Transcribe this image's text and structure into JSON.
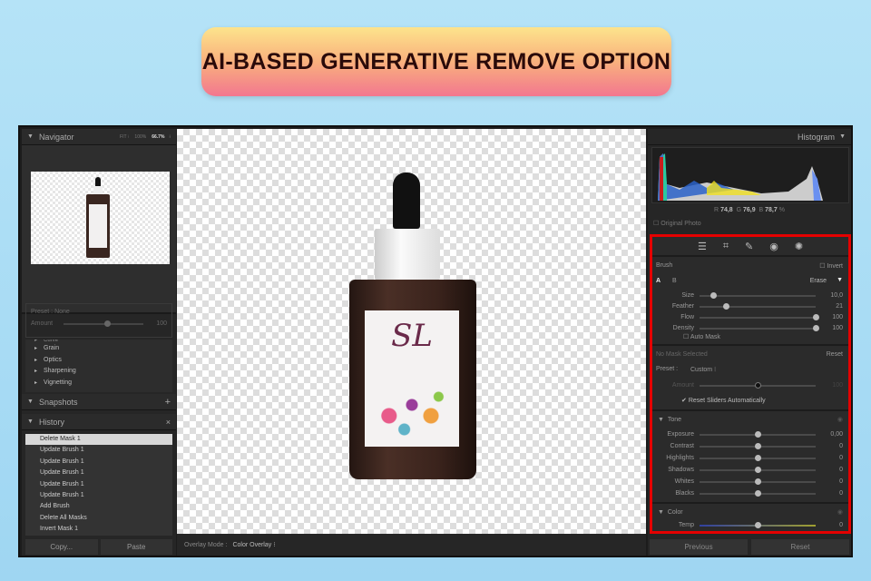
{
  "banner": {
    "title": "AI-BASED GENERATIVE REMOVE OPTION"
  },
  "navigator": {
    "title": "Navigator",
    "fit": "FIT ⁝",
    "zoom100": "100%",
    "zoom": "66.7%",
    "more": "⁝"
  },
  "preset": {
    "label": "Preset : None",
    "amount_label": "Amount",
    "amount": "100"
  },
  "details": [
    "Curve",
    "Grain",
    "Optics",
    "Sharpening",
    "Vignetting"
  ],
  "snapshots": {
    "title": "Snapshots",
    "add": "+"
  },
  "history": {
    "title": "History",
    "clear": "×",
    "items": [
      "Delete Mask 1",
      "Update Brush 1",
      "Update Brush 1",
      "Update Brush 1",
      "Update Brush 1",
      "Update Brush 1",
      "Add Brush",
      "Delete All Masks",
      "Invert Mask 1"
    ]
  },
  "left_buttons": {
    "copy": "Copy...",
    "paste": "Paste"
  },
  "toolbar": {
    "overlay_label": "Overlay Mode :",
    "overlay_value": "Color Overlay ⁝"
  },
  "histogram": {
    "title": "Histogram",
    "r_label": "R",
    "r": "74,8",
    "g_label": "G",
    "g": "76,9",
    "b_label": "B",
    "b": "78,7",
    "pct": "%",
    "original": "Original Photo"
  },
  "brush": {
    "title": "Brush",
    "invert": "Invert",
    "a": "A",
    "b": "B",
    "erase": "Erase",
    "auto_mask": "Auto Mask",
    "sliders": [
      {
        "label": "Size",
        "value": "10,0",
        "pos": 0.12
      },
      {
        "label": "Feather",
        "value": "21",
        "pos": 0.23
      },
      {
        "label": "Flow",
        "value": "100",
        "pos": 1
      },
      {
        "label": "Density",
        "value": "100",
        "pos": 1
      }
    ]
  },
  "mask": {
    "none": "No Mask Selected",
    "reset": "Reset",
    "preset_label": "Preset :",
    "preset_value": "Custom ⁝",
    "amount_label": "Amount",
    "amount": "100",
    "reset_auto": "Reset Sliders Automatically"
  },
  "tone": {
    "title": "Tone",
    "sliders": [
      {
        "label": "Exposure",
        "value": "0,00"
      },
      {
        "label": "Contrast",
        "value": "0"
      },
      {
        "label": "Highlights",
        "value": "0"
      },
      {
        "label": "Shadows",
        "value": "0"
      },
      {
        "label": "Whites",
        "value": "0"
      },
      {
        "label": "Blacks",
        "value": "0"
      }
    ]
  },
  "color": {
    "title": "Color",
    "temp_label": "Temp",
    "temp": "0"
  },
  "right_buttons": {
    "previous": "Previous",
    "reset": "Reset"
  },
  "logo_text": "SL",
  "colors": {
    "highlight": "#e50000"
  }
}
